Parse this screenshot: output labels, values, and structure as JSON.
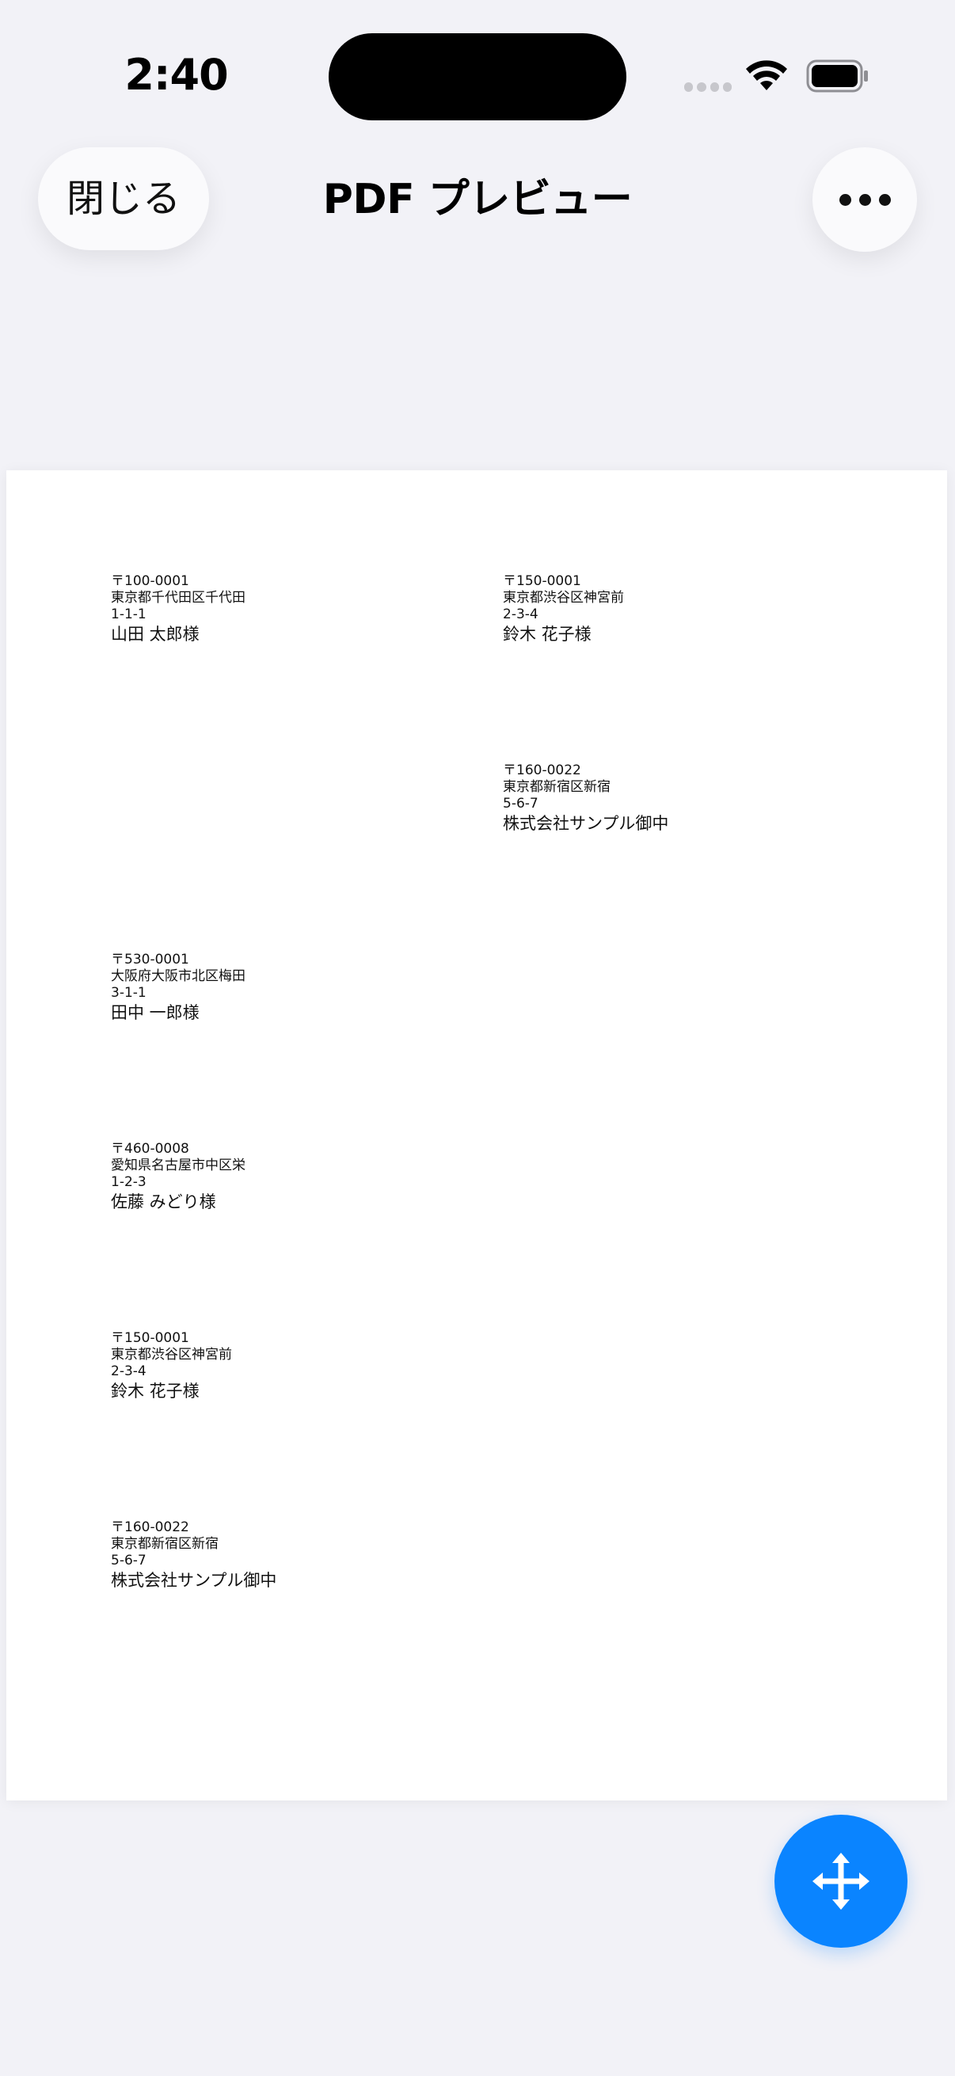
{
  "status_bar": {
    "time": "2:40"
  },
  "nav": {
    "close_label": "閉じる",
    "title": "PDF プレビュー",
    "more_icon": "ellipsis-icon"
  },
  "labels": [
    {
      "zip": "〒100-0001",
      "address": "東京都千代田区千代田",
      "number": "1-1-1",
      "name": "山田 太郎様"
    },
    {
      "zip": "〒150-0001",
      "address": "東京都渋谷区神宮前",
      "number": "2-3-4",
      "name": "鈴木 花子様"
    },
    {
      "zip": "〒160-0022",
      "address": "東京都新宿区新宿",
      "number": "5-6-7",
      "name": "株式会社サンプル御中"
    },
    {
      "zip": "〒530-0001",
      "address": "大阪府大阪市北区梅田",
      "number": "3-1-1",
      "name": "田中 一郎様"
    },
    {
      "zip": "〒460-0008",
      "address": "愛知県名古屋市中区栄",
      "number": "1-2-3",
      "name": "佐藤 みどり様"
    },
    {
      "zip": "〒150-0001",
      "address": "東京都渋谷区神宮前",
      "number": "2-3-4",
      "name": "鈴木 花子様"
    },
    {
      "zip": "〒160-0022",
      "address": "東京都新宿区新宿",
      "number": "5-6-7",
      "name": "株式会社サンプル御中"
    }
  ],
  "fab": {
    "icon": "move-arrows-icon"
  },
  "colors": {
    "accent": "#0A84FF",
    "background": "#F2F2F7",
    "page": "#FFFFFF"
  }
}
